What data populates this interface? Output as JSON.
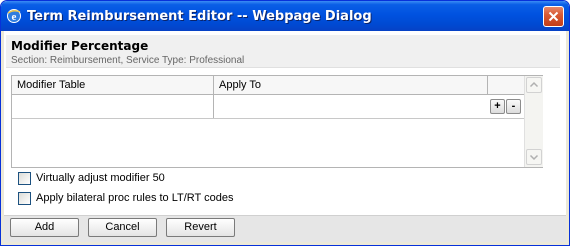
{
  "window": {
    "title": "Term Reimbursement Editor -- Webpage Dialog"
  },
  "header": {
    "title": "Modifier Percentage",
    "subtitle": "Section: Reimbursement, Service Type: Professional"
  },
  "grid": {
    "columns": [
      "Modifier Table",
      "Apply To"
    ],
    "add_label": "+",
    "remove_label": "-"
  },
  "options": [
    {
      "label": "Virtually adjust modifier 50",
      "checked": false
    },
    {
      "label": "Apply bilateral proc rules to LT/RT codes",
      "checked": false
    }
  ],
  "footer": {
    "add_label": "Add",
    "cancel_label": "Cancel",
    "revert_label": "Revert"
  }
}
